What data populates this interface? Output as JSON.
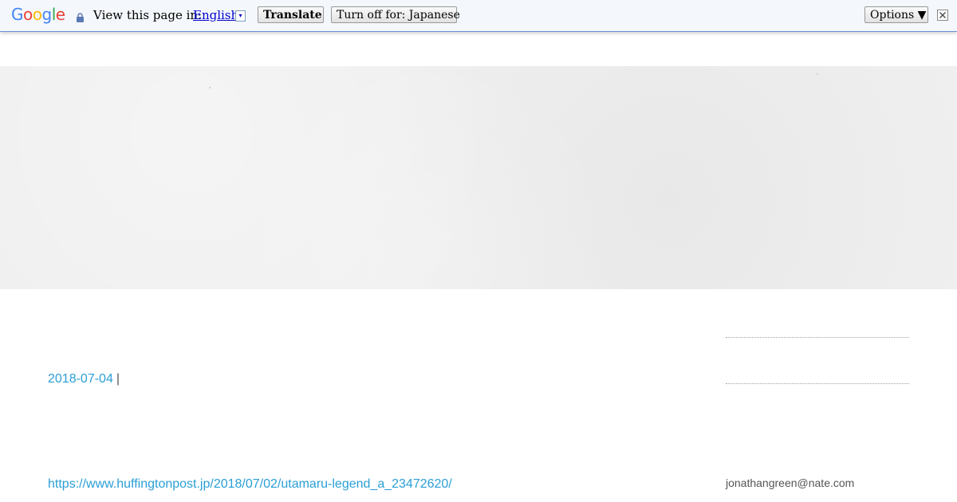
{
  "translate_bar": {
    "logo_letters": [
      {
        "char": "G",
        "color": "#4285f4"
      },
      {
        "char": "o",
        "color": "#ea4335"
      },
      {
        "char": "o",
        "color": "#fbbc05"
      },
      {
        "char": "g",
        "color": "#4285f4"
      },
      {
        "char": "l",
        "color": "#34a853"
      },
      {
        "char": "e",
        "color": "#ea4335"
      }
    ],
    "lock_icon": "lock-icon",
    "view_label": "View this page in:",
    "language": "English",
    "language_arrow": "▾",
    "translate_button": "Translate",
    "turn_off_button": "Turn off for: Japanese",
    "options_button": "Options ▼",
    "close_icon": "close-icon",
    "colors": {
      "bar_background": "#f4f7fc",
      "bar_border": "#6b90da",
      "link": "#0000cc"
    }
  },
  "post": {
    "date": "2018-07-04",
    "separator": "|",
    "link_url_text": "https://www.huffingtonpost.jp/2018/07/02/utamaru-legend_a_23472620/",
    "link_color": "#2a9fd6"
  },
  "sidebar": {
    "email": "jonathangreen@nate.com"
  }
}
